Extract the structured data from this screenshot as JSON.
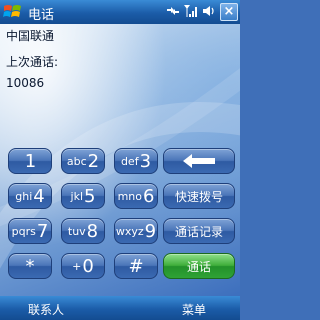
{
  "titlebar": {
    "title": "电话",
    "close_label": "×"
  },
  "info": {
    "carrier": "中国联通",
    "last_call_label": "上次通话:",
    "last_call_number": "10086"
  },
  "keypad": {
    "keys": [
      {
        "sub": "",
        "digit": "1"
      },
      {
        "sub": "abc",
        "digit": "2"
      },
      {
        "sub": "def",
        "digit": "3"
      },
      {
        "sub": "ghi",
        "digit": "4"
      },
      {
        "sub": "jkl",
        "digit": "5"
      },
      {
        "sub": "mno",
        "digit": "6"
      },
      {
        "sub": "pqrs",
        "digit": "7"
      },
      {
        "sub": "tuv",
        "digit": "8"
      },
      {
        "sub": "wxyz",
        "digit": "9"
      },
      {
        "sub": "",
        "digit": "*"
      },
      {
        "sub": "+",
        "digit": "0"
      },
      {
        "sub": "",
        "digit": "#"
      }
    ],
    "speed_dial_label": "快速拨号",
    "call_log_label": "通话记录",
    "call_label": "通话"
  },
  "softkeys": {
    "left": "联系人",
    "right": "菜单"
  },
  "colors": {
    "titlebar": "#1b5ca8",
    "key": "#3b6ab2",
    "call_key": "#2fa236"
  }
}
